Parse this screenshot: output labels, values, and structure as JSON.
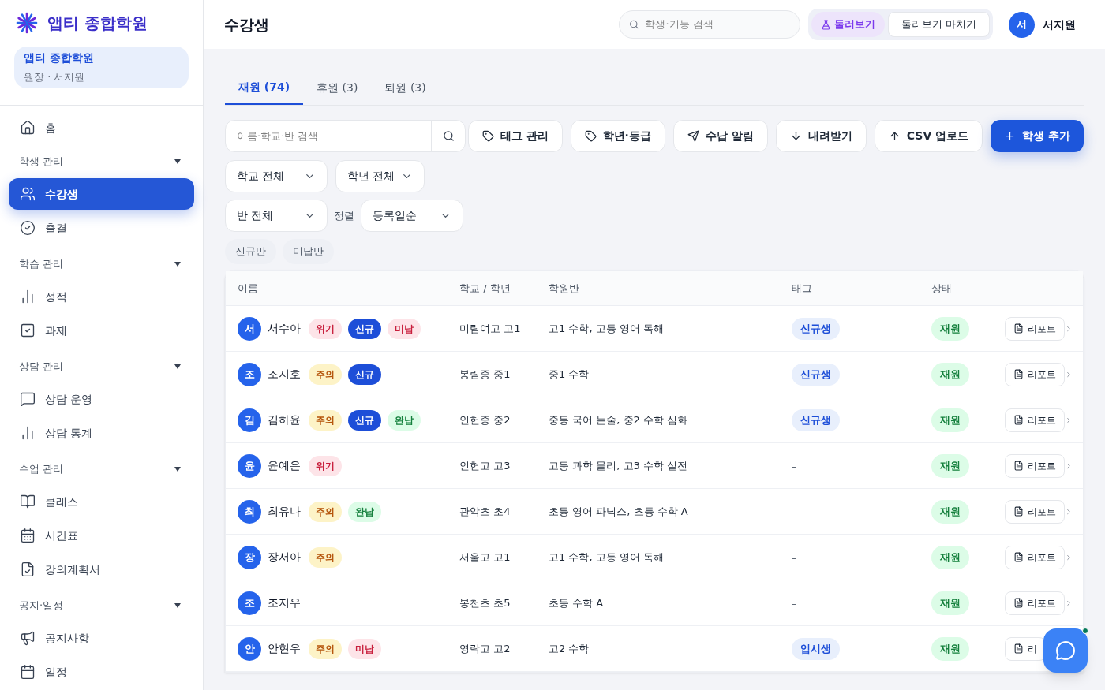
{
  "brand": {
    "name": "앱티 종합학원"
  },
  "org_card": {
    "name": "앱티 종합학원",
    "role": "원장 · 서지원"
  },
  "sidebar": {
    "home": {
      "label": "홈",
      "selected": false
    },
    "sections": [
      {
        "title": "학생 관리",
        "expanded": true,
        "items": [
          {
            "label": "수강생",
            "selected": true
          },
          {
            "label": "출결",
            "selected": false
          }
        ]
      },
      {
        "title": "학습 관리",
        "expanded": true,
        "items": [
          {
            "label": "성적",
            "selected": false
          },
          {
            "label": "과제",
            "selected": false
          }
        ]
      },
      {
        "title": "상담 관리",
        "expanded": true,
        "items": [
          {
            "label": "상담 운영",
            "selected": false
          },
          {
            "label": "상담 통계",
            "selected": false
          }
        ]
      },
      {
        "title": "수업 관리",
        "expanded": true,
        "items": [
          {
            "label": "클래스",
            "selected": false
          },
          {
            "label": "시간표",
            "selected": false
          },
          {
            "label": "강의계획서",
            "selected": false
          }
        ]
      },
      {
        "title": "공지·일정",
        "expanded": true,
        "items": [
          {
            "label": "공지사항",
            "selected": false
          },
          {
            "label": "일정",
            "selected": false
          }
        ]
      }
    ]
  },
  "header": {
    "title": "수강생",
    "search": {
      "placeholder": "학생·기능 검색"
    },
    "tour": {
      "label": "둘러보기",
      "on": true
    },
    "tour_end": "둘러보기 마치기",
    "user": {
      "initial": "서",
      "name": "서지원"
    }
  },
  "tabs": [
    {
      "label": "재원 (74)",
      "selected": true
    },
    {
      "label": "휴원 (3)",
      "selected": false
    },
    {
      "label": "퇴원 (3)",
      "selected": false
    }
  ],
  "search": {
    "placeholder": "이름·학교·반 검색"
  },
  "actions": [
    {
      "label": "태그 관리",
      "kind": "secondary"
    },
    {
      "label": "학년·등급",
      "kind": "secondary"
    },
    {
      "label": "수납 알림",
      "kind": "secondary"
    },
    {
      "label": "내려받기",
      "kind": "secondary"
    },
    {
      "label": "CSV 업로드",
      "kind": "secondary"
    },
    {
      "label": "학생 추가",
      "kind": "primary"
    }
  ],
  "filters": [
    {
      "value": "학교 전체"
    },
    {
      "value": "학년 전체"
    },
    {
      "value": "반 전체"
    }
  ],
  "sort": {
    "label": "정렬",
    "value": "등록일순"
  },
  "chips": [
    {
      "label": "신규만",
      "selected": false
    },
    {
      "label": "미납만",
      "selected": false
    }
  ],
  "table": {
    "columns": [
      "이름",
      "학교 / 학년",
      "학원반",
      "태그",
      "상태"
    ],
    "rows": [
      {
        "initial": "서",
        "name": "서수아",
        "badges": [
          {
            "label": "위기",
            "kind": "danger"
          },
          {
            "label": "신규",
            "kind": "new"
          },
          {
            "label": "미납",
            "kind": "unpaid"
          }
        ],
        "school": "미림여고 고1",
        "classes": "고1 수학, 고등 영어 독해",
        "tag": "신규생",
        "status": "재원",
        "report": "리포트"
      },
      {
        "initial": "조",
        "name": "조지호",
        "badges": [
          {
            "label": "주의",
            "kind": "warning"
          },
          {
            "label": "신규",
            "kind": "new"
          }
        ],
        "school": "봉림중 중1",
        "classes": "중1 수학",
        "tag": "신규생",
        "status": "재원",
        "report": "리포트"
      },
      {
        "initial": "김",
        "name": "김하윤",
        "badges": [
          {
            "label": "주의",
            "kind": "warning"
          },
          {
            "label": "신규",
            "kind": "new"
          },
          {
            "label": "완납",
            "kind": "paid"
          }
        ],
        "school": "인헌중 중2",
        "classes": "중등 국어 논술, 중2 수학 심화",
        "tag": "신규생",
        "status": "재원",
        "report": "리포트"
      },
      {
        "initial": "윤",
        "name": "윤예은",
        "badges": [
          {
            "label": "위기",
            "kind": "danger"
          }
        ],
        "school": "인헌고 고3",
        "classes": "고등 과학 물리, 고3 수학 실전",
        "tag": "–",
        "status": "재원",
        "report": "리포트"
      },
      {
        "initial": "최",
        "name": "최유나",
        "badges": [
          {
            "label": "주의",
            "kind": "warning"
          },
          {
            "label": "완납",
            "kind": "paid"
          }
        ],
        "school": "관악초 초4",
        "classes": "초등 영어 파닉스, 초등 수학 A",
        "tag": "–",
        "status": "재원",
        "report": "리포트"
      },
      {
        "initial": "장",
        "name": "장서아",
        "badges": [
          {
            "label": "주의",
            "kind": "warning"
          }
        ],
        "school": "서울고 고1",
        "classes": "고1 수학, 고등 영어 독해",
        "tag": "–",
        "status": "재원",
        "report": "리포트"
      },
      {
        "initial": "조",
        "name": "조지우",
        "badges": [],
        "school": "봉천초 초5",
        "classes": "초등 수학 A",
        "tag": "–",
        "status": "재원",
        "report": "리포트"
      },
      {
        "initial": "안",
        "name": "안현우",
        "badges": [
          {
            "label": "주의",
            "kind": "warning"
          },
          {
            "label": "미납",
            "kind": "unpaid"
          }
        ],
        "school": "영락고 고2",
        "classes": "고2 수학",
        "tag": "입시생",
        "status": "재원",
        "report": "리"
      }
    ]
  },
  "chat": {
    "online": true
  }
}
